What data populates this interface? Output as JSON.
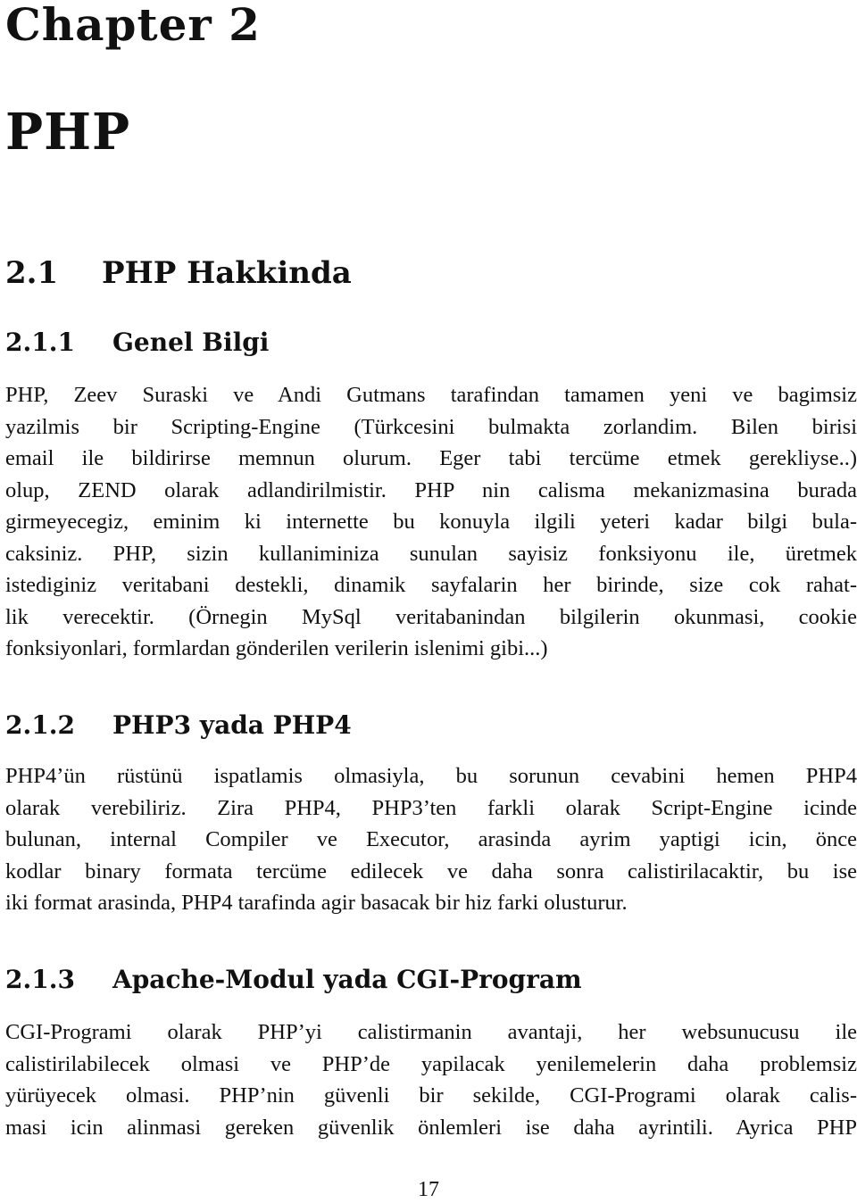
{
  "chapter": {
    "label": "Chapter 2",
    "title": "PHP"
  },
  "sections": [
    {
      "number": "2.1",
      "title": "PHP Hakkinda"
    }
  ],
  "subsections": [
    {
      "number": "2.1.1",
      "title": "Genel Bilgi",
      "lines": [
        "PHP, Zeev Suraski ve Andi Gutmans tarafindan tamamen yeni ve bagimsiz",
        "yazilmis bir Scripting-Engine (Türkcesini bulmakta zorlandim.  Bilen birisi",
        "email ile bildirirse memnun olurum.  Eger tabi tercüme etmek gerekliyse..)",
        "olup, ZEND olarak adlandirilmistir.  PHP nin calisma mekanizmasina burada",
        "girmeyecegiz, eminim ki internette bu konuyla ilgili yeteri kadar bilgi bula-",
        "caksiniz.  PHP, sizin kullaniminiza sunulan sayisiz fonksiyonu ile, üretmek",
        "istediginiz veritabani destekli, dinamik sayfalarin her birinde, size cok rahat-",
        "lik verecektir.  (Örnegin MySql veritabanindan bilgilerin okunmasi, cookie",
        "fonksiyonlari, formlardan gönderilen verilerin islenimi gibi...)"
      ]
    },
    {
      "number": "2.1.2",
      "title": "PHP3 yada PHP4",
      "lines": [
        "PHP4’ün rüstünü ispatlamis olmasiyla, bu sorunun cevabini hemen PHP4",
        "olarak verebiliriz.  Zira PHP4, PHP3’ten farkli olarak Script-Engine icinde",
        "bulunan, internal Compiler ve Executor, arasinda ayrim yaptigi icin, önce",
        "kodlar binary formata tercüme edilecek ve daha sonra calistirilacaktir, bu ise",
        "iki format arasinda, PHP4 tarafinda agir basacak bir hiz farki olusturur."
      ]
    },
    {
      "number": "2.1.3",
      "title": "Apache-Modul yada CGI-Program",
      "lines": [
        "CGI-Programi olarak PHP’yi calistirmanin avantaji, her websunucusu ile",
        "calistirilabilecek olmasi ve PHP’de yapilacak yenilemelerin daha problemsiz",
        "yürüyecek olmasi.  PHP’nin güvenli bir sekilde, CGI-Programi olarak calis-",
        "masi icin alinmasi gereken güvenlik önlemleri ise daha ayrintili.  Ayrica PHP"
      ]
    }
  ],
  "footer": {
    "page_number": "17"
  }
}
